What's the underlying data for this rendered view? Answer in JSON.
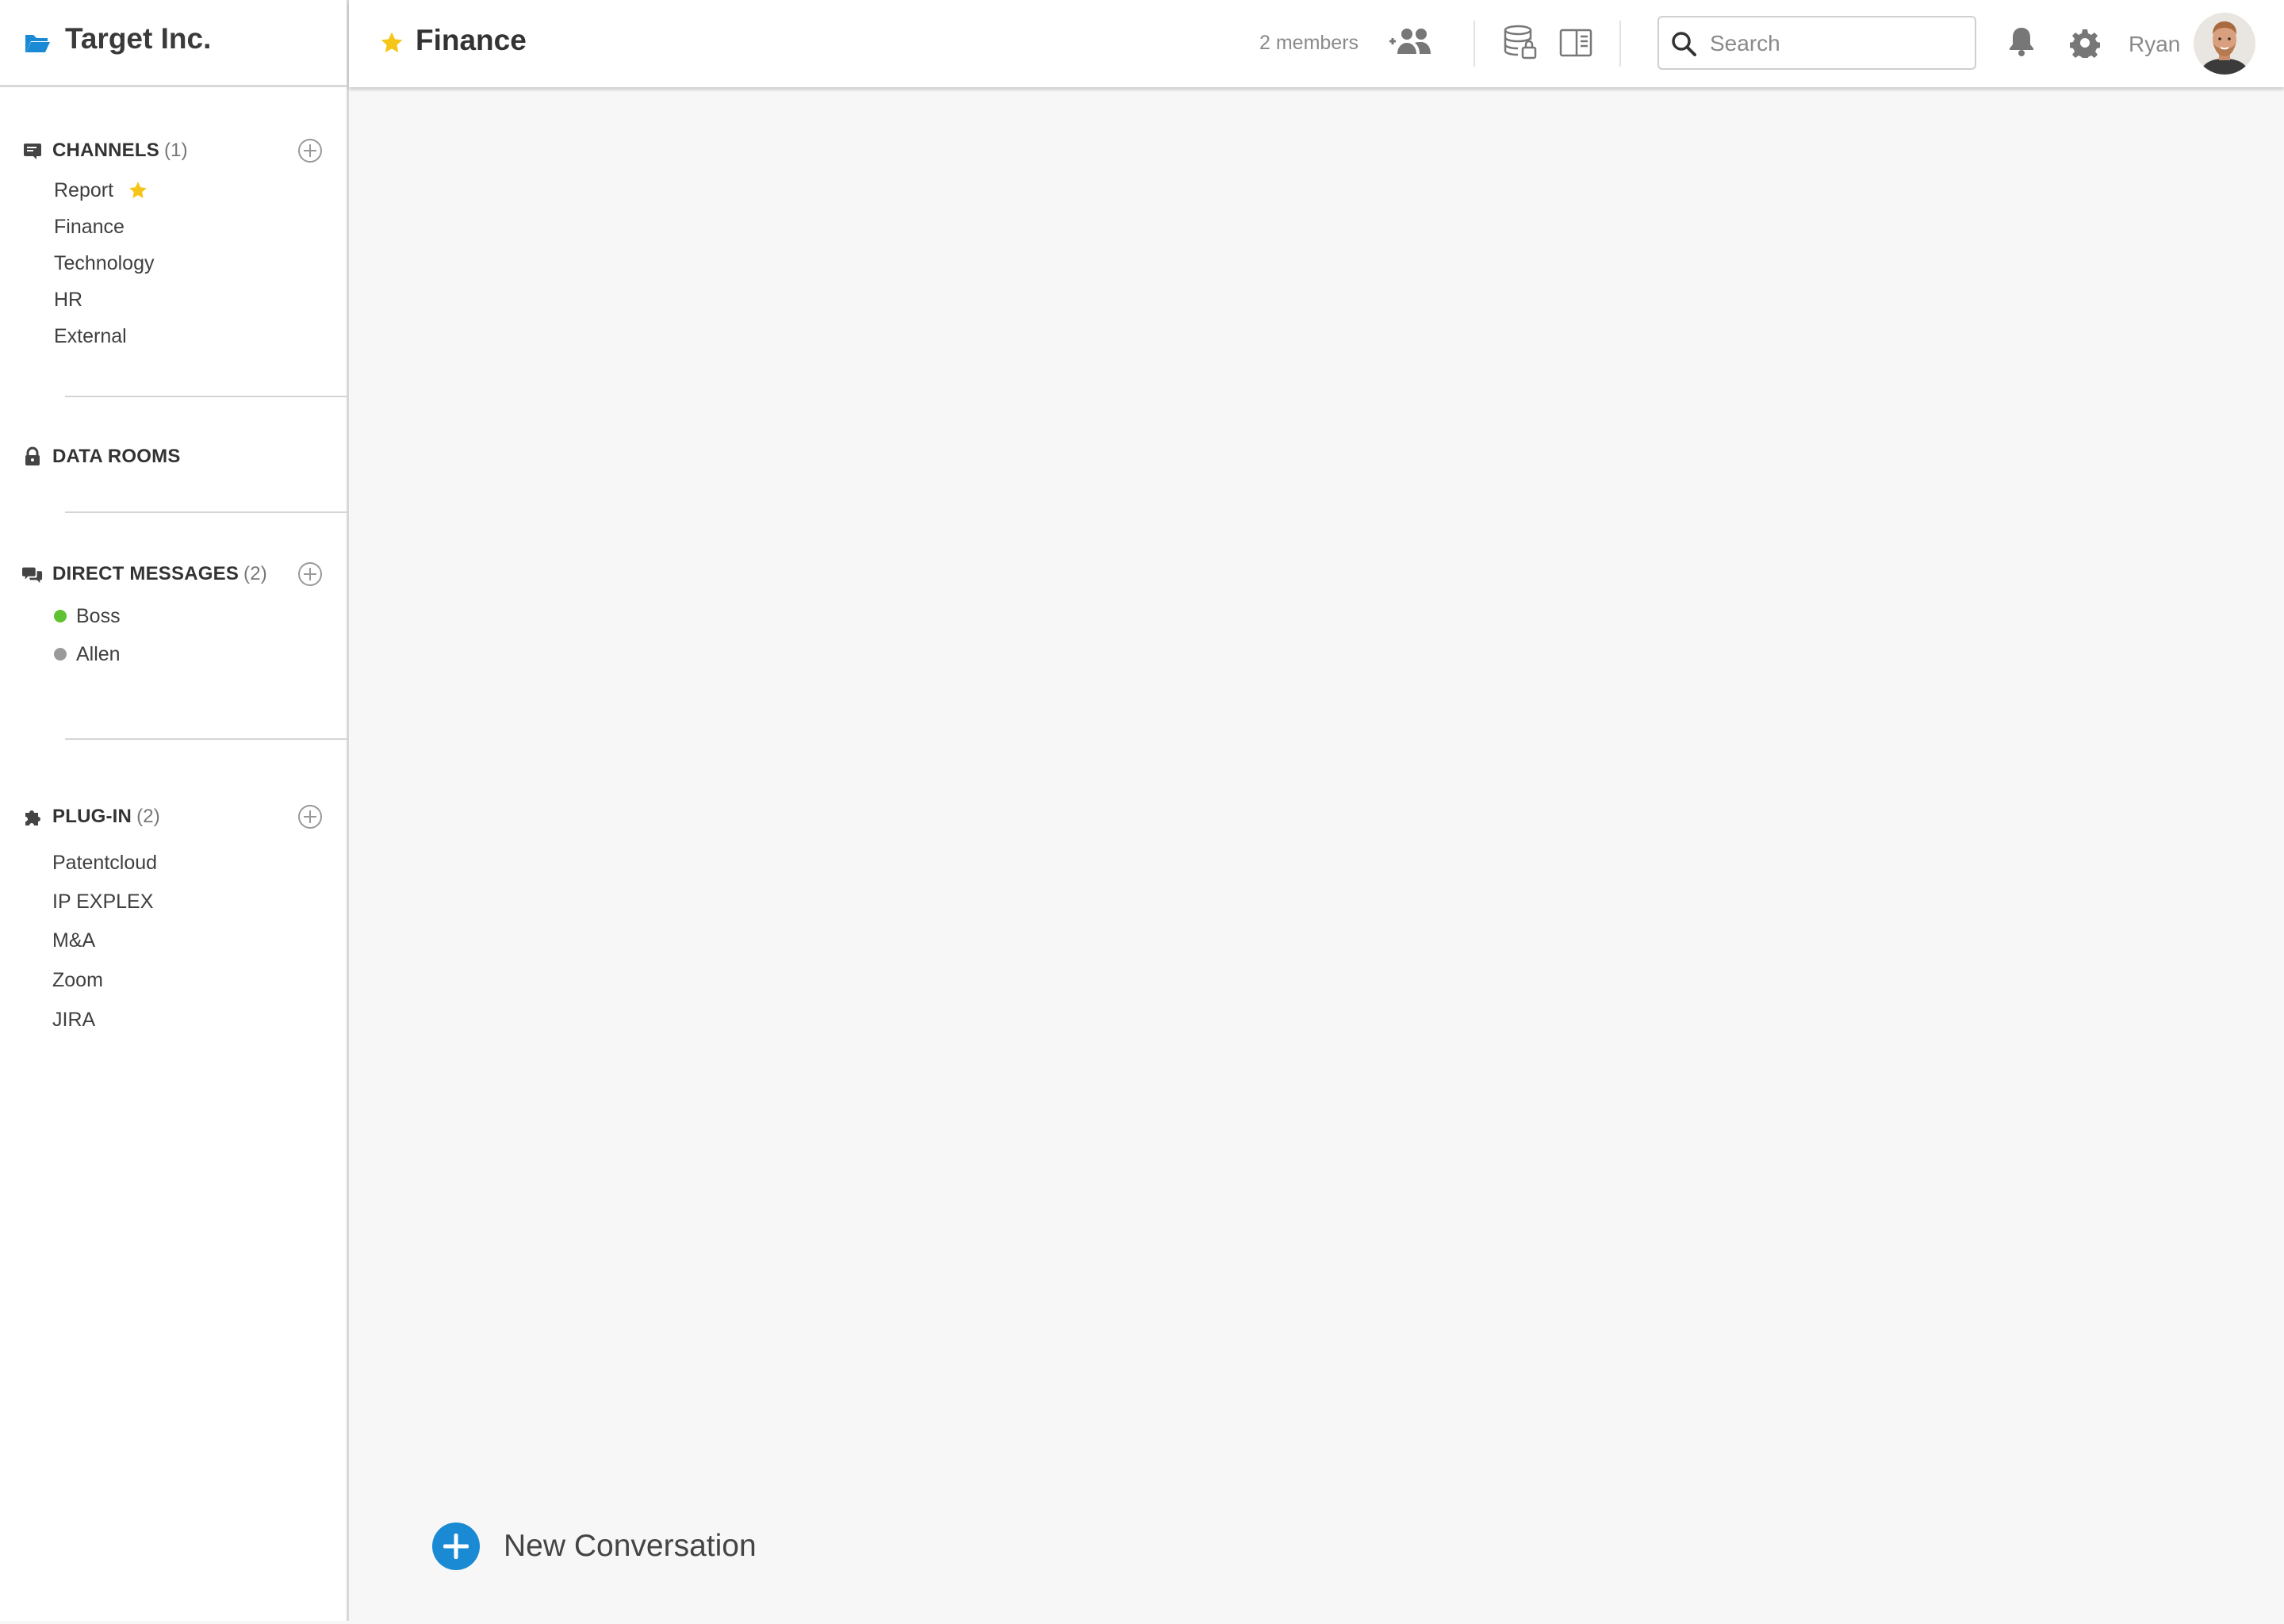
{
  "app": {
    "org_name": "Target Inc.",
    "accent": "#1a8ad4",
    "star_color": "#f5c518"
  },
  "sidebar": {
    "channels": {
      "label": "CHANNELS",
      "count": "(1)",
      "icon": "channel-icon",
      "items": [
        {
          "label": "Report",
          "starred": true
        },
        {
          "label": "Finance"
        },
        {
          "label": "Technology"
        },
        {
          "label": "HR"
        },
        {
          "label": "External"
        }
      ]
    },
    "data_rooms": {
      "label": "DATA ROOMS",
      "icon": "lock-icon"
    },
    "direct_messages": {
      "label": "DIRECT MESSAGES",
      "count": "(2)",
      "icon": "chat-bubbles-icon",
      "items": [
        {
          "label": "Boss",
          "status": "online",
          "status_color": "#5ec232"
        },
        {
          "label": "Allen",
          "status": "offline",
          "status_color": "#9a9a9a"
        }
      ]
    },
    "plugins": {
      "label": "PLUG-IN",
      "count": "(2)",
      "icon": "puzzle-icon",
      "items": [
        {
          "label": "Patentcloud"
        },
        {
          "label": "IP EXPLEX"
        },
        {
          "label": "M&A"
        },
        {
          "label": "Zoom"
        },
        {
          "label": "JIRA"
        }
      ]
    }
  },
  "header": {
    "channel_title": "Finance",
    "members": "2 members",
    "search_placeholder": "Search",
    "user_name": "Ryan"
  },
  "main": {
    "new_conversation_label": "New Conversation"
  }
}
